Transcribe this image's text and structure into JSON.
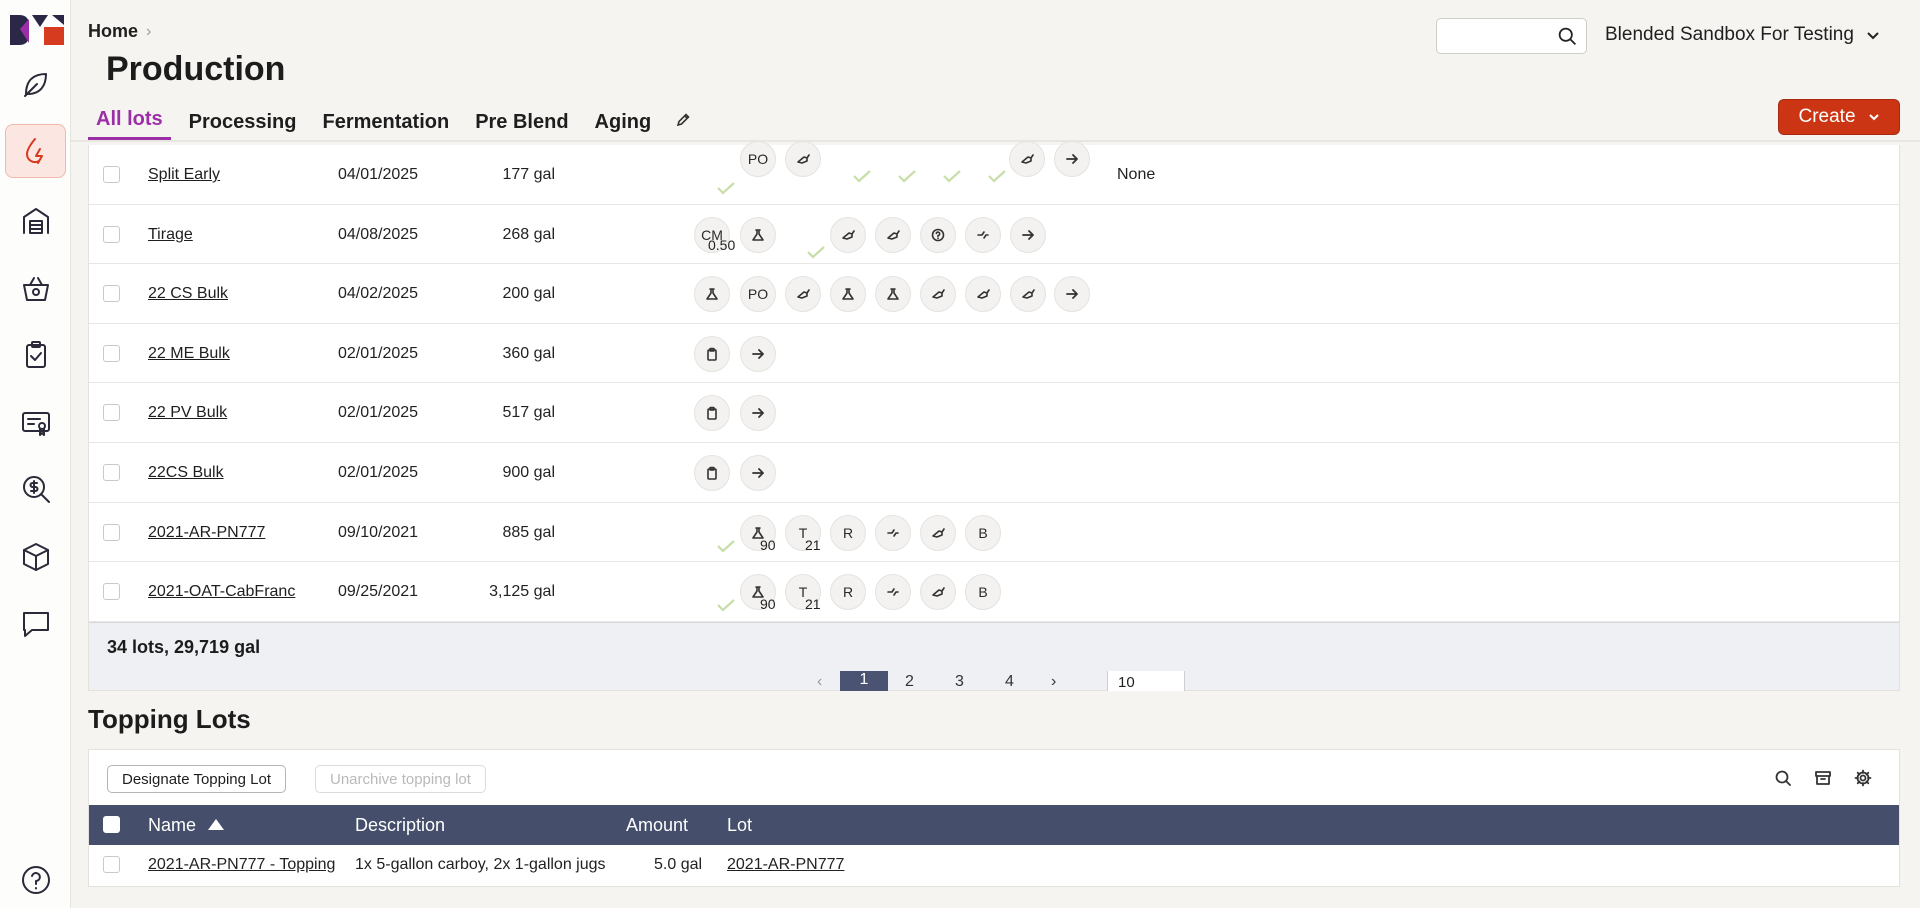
{
  "app": {
    "org_name": "Blended Sandbox For Testing",
    "search_placeholder": ""
  },
  "nav": {
    "items": [
      {
        "name": "vineyard",
        "icon": "leaf-icon"
      },
      {
        "name": "production",
        "icon": "drop-icon",
        "active": true
      },
      {
        "name": "facility",
        "icon": "building-icon"
      },
      {
        "name": "sales",
        "icon": "basket-icon"
      },
      {
        "name": "tasks",
        "icon": "clipboard-check-icon"
      },
      {
        "name": "compliance",
        "icon": "certificate-icon"
      },
      {
        "name": "costing",
        "icon": "dollar-search-icon"
      },
      {
        "name": "inventory",
        "icon": "box-icon"
      },
      {
        "name": "messages",
        "icon": "chat-icon"
      }
    ],
    "help_icon": "help-icon"
  },
  "header": {
    "breadcrumb": "Home",
    "title": "Production",
    "create_label": "Create"
  },
  "tabs": [
    {
      "label": "All lots",
      "active": true
    },
    {
      "label": "Processing"
    },
    {
      "label": "Fermentation"
    },
    {
      "label": "Pre Blend"
    },
    {
      "label": "Aging"
    }
  ],
  "lots": [
    {
      "name": "Split Early",
      "date": "04/01/2025",
      "volume": "177 gal",
      "extra": "None"
    },
    {
      "name": "Tirage",
      "date": "04/08/2025",
      "volume": "268 gal",
      "extra": ""
    },
    {
      "name": "22 CS Bulk",
      "date": "04/02/2025",
      "volume": "200 gal",
      "extra": ""
    },
    {
      "name": "22 ME Bulk",
      "date": "02/01/2025",
      "volume": "360 gal",
      "extra": ""
    },
    {
      "name": "22 PV Bulk",
      "date": "02/01/2025",
      "volume": "517 gal",
      "extra": ""
    },
    {
      "name": "22CS Bulk",
      "date": "02/01/2025",
      "volume": "900 gal",
      "extra": ""
    },
    {
      "name": "2021-AR-PN777",
      "date": "09/10/2021",
      "volume": "885 gal",
      "extra": ""
    },
    {
      "name": "2021-OAT-CabFranc",
      "date": "09/25/2021",
      "volume": "3,125 gal",
      "extra": ""
    }
  ],
  "action_labels": {
    "po": "PO",
    "cm": "CM",
    "cm_sub": "0.50",
    "t": "T",
    "r": "R",
    "b": "B",
    "sub_90": "90",
    "sub_21": "21"
  },
  "lots_summary": "34 lots, 29,719 gal",
  "pagination": {
    "pages": [
      "1",
      "2",
      "3",
      "4"
    ],
    "current": "1",
    "page_size": "10"
  },
  "topping": {
    "section_title": "Topping Lots",
    "designate_label": "Designate Topping Lot",
    "unarchive_label": "Unarchive topping lot",
    "columns": [
      "Name",
      "Description",
      "Amount",
      "Lot"
    ],
    "rows": [
      {
        "name": "2021-AR-PN777 - Topping",
        "description": "1x 5-gallon carboy, 2x 1-gallon jugs",
        "amount": "5.0 gal",
        "lot": "2021-AR-PN777"
      }
    ]
  },
  "colors": {
    "accent_purple": "#9c2fa8",
    "create_red": "#cc3514",
    "table_header": "#454f6b",
    "check_green": "#c8dea8"
  }
}
